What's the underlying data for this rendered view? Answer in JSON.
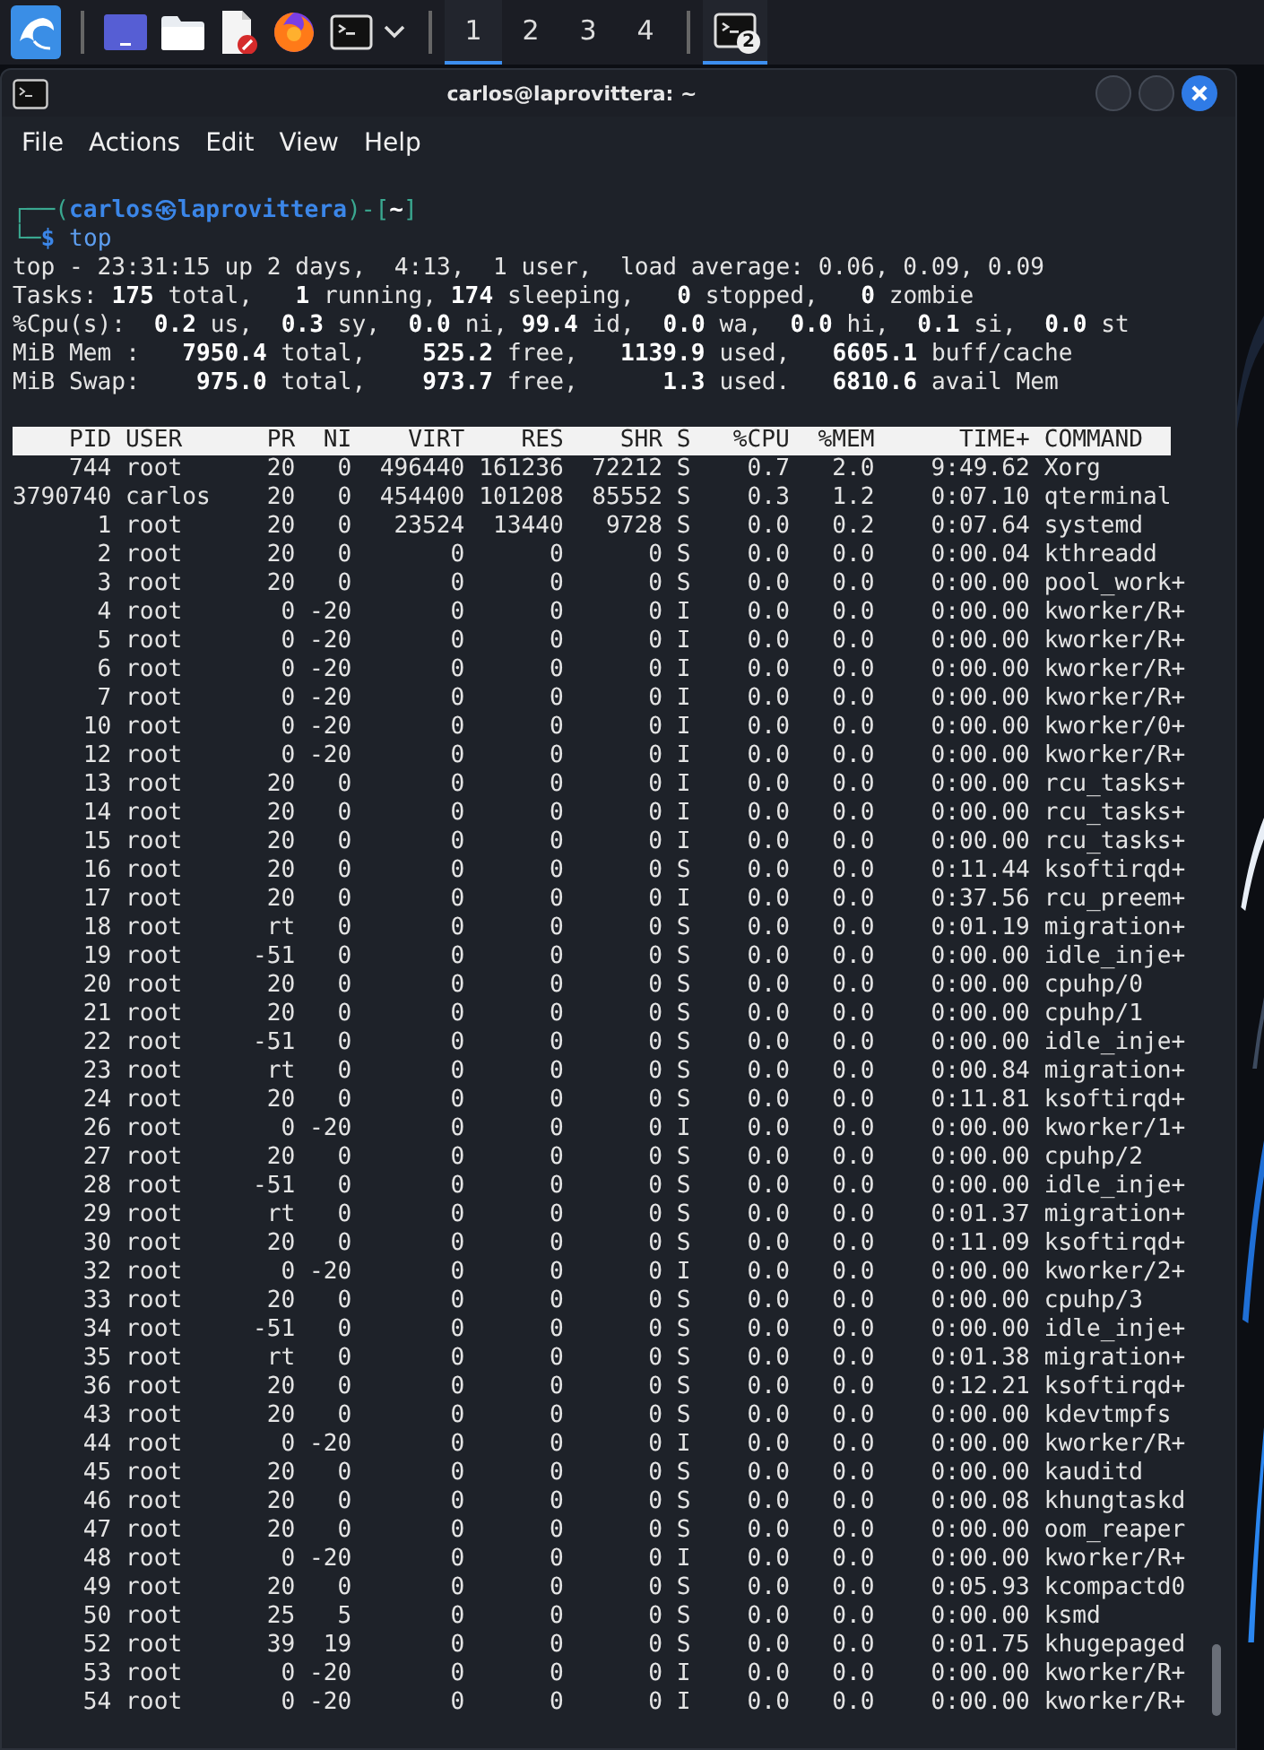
{
  "taskbar": {
    "launchers": [
      {
        "kind": "menu"
      },
      {
        "kind": "desktop"
      },
      {
        "kind": "files"
      },
      {
        "kind": "editor"
      },
      {
        "kind": "browser"
      },
      {
        "kind": "terminal"
      },
      {
        "kind": "dropdown"
      }
    ],
    "workspaces": [
      {
        "label": "1",
        "selected": true
      },
      {
        "label": "2",
        "selected": false
      },
      {
        "label": "3",
        "selected": false
      },
      {
        "label": "4",
        "selected": false
      }
    ],
    "tasks": [
      {
        "kind": "terminal",
        "badge": "2",
        "selected": true
      }
    ]
  },
  "window": {
    "title": "carlos@laprovittera: ~",
    "menu": [
      "File",
      "Actions",
      "Edit",
      "View",
      "Help"
    ]
  },
  "terminal": {
    "prompt": {
      "open": "┌──(",
      "user": "carlos",
      "at": "㉿",
      "host": "laprovittera",
      "mid": ")-[",
      "path": "~",
      "close": "]",
      "second": "└─",
      "symbol": "$",
      "command": "top"
    },
    "summary": [
      "top - 23:31:15 up 2 days,  4:13,  1 user,  load average: 0.06, 0.09, 0.09",
      "Tasks: **175** total,   **1** running, **174** sleeping,   **0** stopped,   **0** zombie",
      "%Cpu(s):  **0.2** us,  **0.3** sy,  **0.0** ni, **99.4** id,  **0.0** wa,  **0.0** hi,  **0.1** si,  **0.0** st",
      "MiB Mem :   **7950.4** total,    **525.2** free,   **1139.9** used,   **6605.1** buff/cache",
      "MiB Swap:    **975.0** total,    **973.7** free,      **1.3** used.   **6810.6** avail Mem"
    ],
    "table": {
      "columns": [
        "PID",
        "USER",
        "PR",
        "NI",
        "VIRT",
        "RES",
        "SHR",
        "S",
        "%CPU",
        "%MEM",
        "TIME+",
        "COMMAND"
      ],
      "rows": [
        [
          "744",
          "root",
          "20",
          "0",
          "496440",
          "161236",
          "72212",
          "S",
          "0.7",
          "2.0",
          "9:49.62",
          "Xorg"
        ],
        [
          "3790740",
          "carlos",
          "20",
          "0",
          "454400",
          "101208",
          "85552",
          "S",
          "0.3",
          "1.2",
          "0:07.10",
          "qterminal"
        ],
        [
          "1",
          "root",
          "20",
          "0",
          "23524",
          "13440",
          "9728",
          "S",
          "0.0",
          "0.2",
          "0:07.64",
          "systemd"
        ],
        [
          "2",
          "root",
          "20",
          "0",
          "0",
          "0",
          "0",
          "S",
          "0.0",
          "0.0",
          "0:00.04",
          "kthreadd"
        ],
        [
          "3",
          "root",
          "20",
          "0",
          "0",
          "0",
          "0",
          "S",
          "0.0",
          "0.0",
          "0:00.00",
          "pool_work+"
        ],
        [
          "4",
          "root",
          "0",
          "-20",
          "0",
          "0",
          "0",
          "I",
          "0.0",
          "0.0",
          "0:00.00",
          "kworker/R+"
        ],
        [
          "5",
          "root",
          "0",
          "-20",
          "0",
          "0",
          "0",
          "I",
          "0.0",
          "0.0",
          "0:00.00",
          "kworker/R+"
        ],
        [
          "6",
          "root",
          "0",
          "-20",
          "0",
          "0",
          "0",
          "I",
          "0.0",
          "0.0",
          "0:00.00",
          "kworker/R+"
        ],
        [
          "7",
          "root",
          "0",
          "-20",
          "0",
          "0",
          "0",
          "I",
          "0.0",
          "0.0",
          "0:00.00",
          "kworker/R+"
        ],
        [
          "10",
          "root",
          "0",
          "-20",
          "0",
          "0",
          "0",
          "I",
          "0.0",
          "0.0",
          "0:00.00",
          "kworker/0+"
        ],
        [
          "12",
          "root",
          "0",
          "-20",
          "0",
          "0",
          "0",
          "I",
          "0.0",
          "0.0",
          "0:00.00",
          "kworker/R+"
        ],
        [
          "13",
          "root",
          "20",
          "0",
          "0",
          "0",
          "0",
          "I",
          "0.0",
          "0.0",
          "0:00.00",
          "rcu_tasks+"
        ],
        [
          "14",
          "root",
          "20",
          "0",
          "0",
          "0",
          "0",
          "I",
          "0.0",
          "0.0",
          "0:00.00",
          "rcu_tasks+"
        ],
        [
          "15",
          "root",
          "20",
          "0",
          "0",
          "0",
          "0",
          "I",
          "0.0",
          "0.0",
          "0:00.00",
          "rcu_tasks+"
        ],
        [
          "16",
          "root",
          "20",
          "0",
          "0",
          "0",
          "0",
          "S",
          "0.0",
          "0.0",
          "0:11.44",
          "ksoftirqd+"
        ],
        [
          "17",
          "root",
          "20",
          "0",
          "0",
          "0",
          "0",
          "I",
          "0.0",
          "0.0",
          "0:37.56",
          "rcu_preem+"
        ],
        [
          "18",
          "root",
          "rt",
          "0",
          "0",
          "0",
          "0",
          "S",
          "0.0",
          "0.0",
          "0:01.19",
          "migration+"
        ],
        [
          "19",
          "root",
          "-51",
          "0",
          "0",
          "0",
          "0",
          "S",
          "0.0",
          "0.0",
          "0:00.00",
          "idle_inje+"
        ],
        [
          "20",
          "root",
          "20",
          "0",
          "0",
          "0",
          "0",
          "S",
          "0.0",
          "0.0",
          "0:00.00",
          "cpuhp/0"
        ],
        [
          "21",
          "root",
          "20",
          "0",
          "0",
          "0",
          "0",
          "S",
          "0.0",
          "0.0",
          "0:00.00",
          "cpuhp/1"
        ],
        [
          "22",
          "root",
          "-51",
          "0",
          "0",
          "0",
          "0",
          "S",
          "0.0",
          "0.0",
          "0:00.00",
          "idle_inje+"
        ],
        [
          "23",
          "root",
          "rt",
          "0",
          "0",
          "0",
          "0",
          "S",
          "0.0",
          "0.0",
          "0:00.84",
          "migration+"
        ],
        [
          "24",
          "root",
          "20",
          "0",
          "0",
          "0",
          "0",
          "S",
          "0.0",
          "0.0",
          "0:11.81",
          "ksoftirqd+"
        ],
        [
          "26",
          "root",
          "0",
          "-20",
          "0",
          "0",
          "0",
          "I",
          "0.0",
          "0.0",
          "0:00.00",
          "kworker/1+"
        ],
        [
          "27",
          "root",
          "20",
          "0",
          "0",
          "0",
          "0",
          "S",
          "0.0",
          "0.0",
          "0:00.00",
          "cpuhp/2"
        ],
        [
          "28",
          "root",
          "-51",
          "0",
          "0",
          "0",
          "0",
          "S",
          "0.0",
          "0.0",
          "0:00.00",
          "idle_inje+"
        ],
        [
          "29",
          "root",
          "rt",
          "0",
          "0",
          "0",
          "0",
          "S",
          "0.0",
          "0.0",
          "0:01.37",
          "migration+"
        ],
        [
          "30",
          "root",
          "20",
          "0",
          "0",
          "0",
          "0",
          "S",
          "0.0",
          "0.0",
          "0:11.09",
          "ksoftirqd+"
        ],
        [
          "32",
          "root",
          "0",
          "-20",
          "0",
          "0",
          "0",
          "I",
          "0.0",
          "0.0",
          "0:00.00",
          "kworker/2+"
        ],
        [
          "33",
          "root",
          "20",
          "0",
          "0",
          "0",
          "0",
          "S",
          "0.0",
          "0.0",
          "0:00.00",
          "cpuhp/3"
        ],
        [
          "34",
          "root",
          "-51",
          "0",
          "0",
          "0",
          "0",
          "S",
          "0.0",
          "0.0",
          "0:00.00",
          "idle_inje+"
        ],
        [
          "35",
          "root",
          "rt",
          "0",
          "0",
          "0",
          "0",
          "S",
          "0.0",
          "0.0",
          "0:01.38",
          "migration+"
        ],
        [
          "36",
          "root",
          "20",
          "0",
          "0",
          "0",
          "0",
          "S",
          "0.0",
          "0.0",
          "0:12.21",
          "ksoftirqd+"
        ],
        [
          "43",
          "root",
          "20",
          "0",
          "0",
          "0",
          "0",
          "S",
          "0.0",
          "0.0",
          "0:00.00",
          "kdevtmpfs"
        ],
        [
          "44",
          "root",
          "0",
          "-20",
          "0",
          "0",
          "0",
          "I",
          "0.0",
          "0.0",
          "0:00.00",
          "kworker/R+"
        ],
        [
          "45",
          "root",
          "20",
          "0",
          "0",
          "0",
          "0",
          "S",
          "0.0",
          "0.0",
          "0:00.00",
          "kauditd"
        ],
        [
          "46",
          "root",
          "20",
          "0",
          "0",
          "0",
          "0",
          "S",
          "0.0",
          "0.0",
          "0:00.08",
          "khungtaskd"
        ],
        [
          "47",
          "root",
          "20",
          "0",
          "0",
          "0",
          "0",
          "S",
          "0.0",
          "0.0",
          "0:00.00",
          "oom_reaper"
        ],
        [
          "48",
          "root",
          "0",
          "-20",
          "0",
          "0",
          "0",
          "I",
          "0.0",
          "0.0",
          "0:00.00",
          "kworker/R+"
        ],
        [
          "49",
          "root",
          "20",
          "0",
          "0",
          "0",
          "0",
          "S",
          "0.0",
          "0.0",
          "0:05.93",
          "kcompactd0"
        ],
        [
          "50",
          "root",
          "25",
          "5",
          "0",
          "0",
          "0",
          "S",
          "0.0",
          "0.0",
          "0:00.00",
          "ksmd"
        ],
        [
          "52",
          "root",
          "39",
          "19",
          "0",
          "0",
          "0",
          "S",
          "0.0",
          "0.0",
          "0:01.75",
          "khugepaged"
        ],
        [
          "53",
          "root",
          "0",
          "-20",
          "0",
          "0",
          "0",
          "I",
          "0.0",
          "0.0",
          "0:00.00",
          "kworker/R+"
        ],
        [
          "54",
          "root",
          "0",
          "-20",
          "0",
          "0",
          "0",
          "I",
          "0.0",
          "0.0",
          "0:00.00",
          "kworker/R+"
        ]
      ]
    }
  }
}
